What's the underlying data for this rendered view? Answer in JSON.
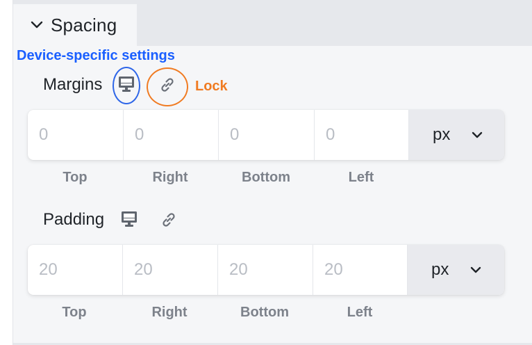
{
  "section": {
    "title": "Spacing",
    "expanded": true,
    "chevron_icon": "chevron-down-icon"
  },
  "annotations": {
    "device": "Device-specific settings",
    "lock": "Lock",
    "device_color": "#1a5fff",
    "lock_color": "#f07b22"
  },
  "margins": {
    "label": "Margins",
    "device_icon": "monitor-icon",
    "lock_icon": "link-icon",
    "fields": [
      {
        "placeholder": "0",
        "value": "",
        "side_label": "Top"
      },
      {
        "placeholder": "0",
        "value": "",
        "side_label": "Right"
      },
      {
        "placeholder": "0",
        "value": "",
        "side_label": "Bottom"
      },
      {
        "placeholder": "0",
        "value": "",
        "side_label": "Left"
      }
    ],
    "unit": "px"
  },
  "padding": {
    "label": "Padding",
    "device_icon": "monitor-icon",
    "lock_icon": "link-icon",
    "fields": [
      {
        "placeholder": "20",
        "value": "",
        "side_label": "Top"
      },
      {
        "placeholder": "20",
        "value": "",
        "side_label": "Right"
      },
      {
        "placeholder": "20",
        "value": "",
        "side_label": "Bottom"
      },
      {
        "placeholder": "20",
        "value": "",
        "side_label": "Left"
      }
    ],
    "unit": "px"
  }
}
